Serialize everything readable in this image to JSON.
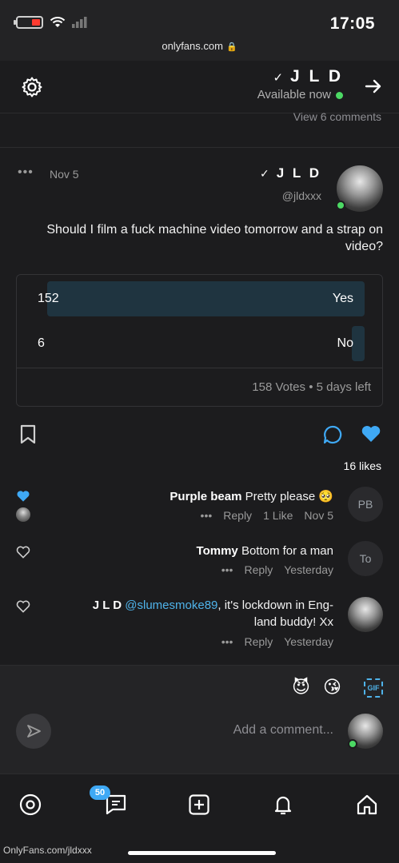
{
  "status": {
    "time": "17:05",
    "url": "onlyfans.com"
  },
  "chat": {
    "title": "J L D",
    "status": "Available now"
  },
  "view_comments": "View 6 comments",
  "post": {
    "name": "J L D",
    "handle": "@jldxxx",
    "date": "Nov 5",
    "more": "•••",
    "text": "Should I film a fuck machine video tomorrow and a strap on video?",
    "poll": {
      "options": [
        {
          "label": "Yes",
          "count": "152",
          "fraction": 0.962
        },
        {
          "label": "No",
          "count": "6",
          "fraction": 0.038
        }
      ],
      "votes": "158 Votes",
      "time_left": "5 days left"
    },
    "likes": "16 likes"
  },
  "comments": [
    {
      "initials": "PB",
      "author": "Purple beam",
      "text": "Pretty please 🥺",
      "date": "Nov 5",
      "likes": "1 Like",
      "reply": "Reply",
      "more": "•••"
    },
    {
      "initials": "To",
      "author": "Tommy",
      "text": "Bottom for a man",
      "date": "Yesterday",
      "reply": "Reply",
      "more": "•••"
    },
    {
      "author": "J L D",
      "mention": "@slumesmoke89",
      "text": ", it's lockdown in Eng-",
      "text2": "land buddy! Xx",
      "date": "Yesterday",
      "reply": "Reply",
      "more": "•••"
    }
  ],
  "composer": {
    "gif": "GIF",
    "emoji1": "😘",
    "emoji2": "😈",
    "placeholder": "Add a comment..."
  },
  "tabbar": {
    "badge": "50",
    "footer_url": "OnlyFans.com/jldxxx"
  },
  "colors": {
    "accent": "#3fa9f5",
    "online": "#4cd964",
    "background": "#1c1c1e"
  }
}
